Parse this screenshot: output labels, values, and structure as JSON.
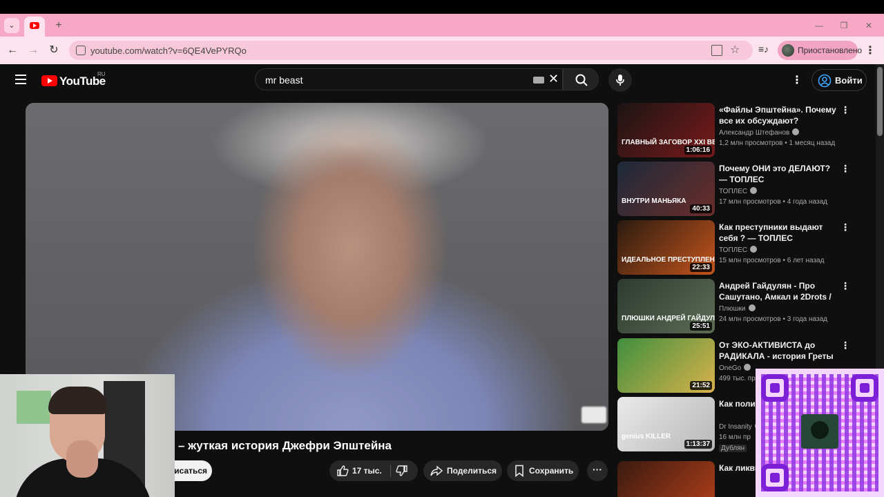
{
  "browser": {
    "url": "youtube.com/watch?v=6QE4VePYRQo",
    "profile_label": "Приостановлено"
  },
  "header": {
    "logo_text": "YouTube",
    "country_code": "RU",
    "search_value": "mr beast",
    "signin_label": "Войти"
  },
  "video": {
    "title": "– жуткая история Джефри Эпштейна",
    "subscribe_label": "писаться",
    "like_count": "17 тыс.",
    "share_label": "Поделиться",
    "save_label": "Сохранить"
  },
  "recommendations": [
    {
      "title": "«Файлы Эпштейна». Почему все их обсуждают?",
      "channel": "Александр Штефанов",
      "meta": "1,2 млн просмотров • 1 месяц назад",
      "duration": "1:06:16",
      "thumb_caption": "ГЛАВНЫЙ ЗАГОВОР XXI ВЕКА",
      "thumb_colors": [
        "#1b1414",
        "#7a1a1a"
      ]
    },
    {
      "title": "Почему ОНИ это ДЕЛАЮТ? — ТОПЛЕС",
      "channel": "ТОПЛЕС",
      "meta": "17 млн просмотров • 4 года назад",
      "duration": "40:33",
      "thumb_caption": "ВНУТРИ МАНЬЯКА",
      "thumb_colors": [
        "#1d2a3a",
        "#6b2d2a"
      ]
    },
    {
      "title": "Как преступники выдают себя ? — ТОПЛЕС",
      "channel": "ТОПЛЕС",
      "meta": "15 млн просмотров • 6 лет назад",
      "duration": "22:33",
      "thumb_caption": "ИДЕАЛЬНОЕ ПРЕСТУПЛЕНИЕ",
      "thumb_colors": [
        "#2b1b10",
        "#c4541c"
      ]
    },
    {
      "title": "Андрей Гайдулян - Про Сашутано, Амкал и 2Drots / ...",
      "channel": "Плюшки",
      "meta": "24 млн просмотров • 3 года назад",
      "duration": "25:51",
      "thumb_caption": "ПЛЮШКИ АНДРЕЙ ГАЙДУЛЯН",
      "thumb_colors": [
        "#2c3a30",
        "#5d6d55"
      ]
    },
    {
      "title": "От ЭКО-АКТИВИСТА до РАДИКАЛА - история Греты ...",
      "channel": "OneGo",
      "meta": "499 тыс. пр",
      "duration": "21:52",
      "thumb_caption": "",
      "thumb_colors": [
        "#3f8f3f",
        "#d9b24a"
      ]
    },
    {
      "title": "Как полиц умного уб",
      "channel": "Dr Insanity",
      "meta": "16 млн пр",
      "extra": "Дублян",
      "duration": "1:13:37",
      "thumb_caption": "genius KILLER",
      "thumb_colors": [
        "#e9e9e9",
        "#b8b8b8"
      ]
    },
    {
      "title": "Как ликви террорист",
      "channel": "",
      "meta": "",
      "duration": "",
      "thumb_caption": "",
      "thumb_colors": [
        "#3a1a10",
        "#b4401a"
      ]
    }
  ]
}
